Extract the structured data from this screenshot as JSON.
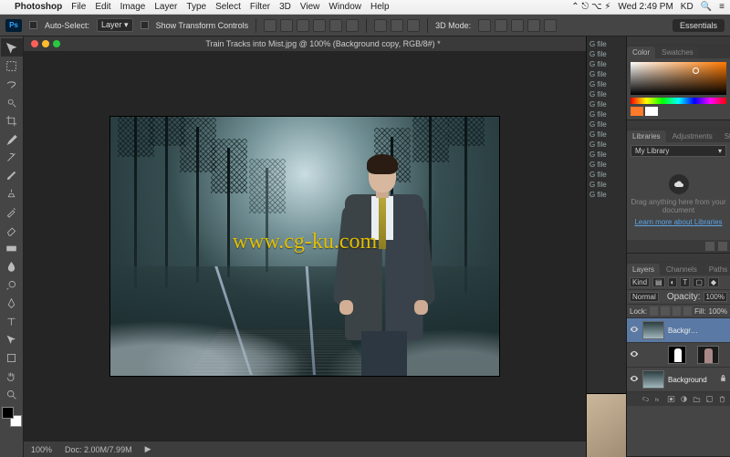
{
  "mac_menubar": {
    "apple_glyph": "",
    "app_name": "Photoshop",
    "items": [
      "File",
      "Edit",
      "Image",
      "Layer",
      "Type",
      "Select",
      "Filter",
      "3D",
      "View",
      "Window",
      "Help"
    ],
    "right_status": {
      "time": "Wed 2:49 PM",
      "user": "KD"
    },
    "right_icons": [
      "bluetooth-icon",
      "wifi-icon",
      "volume-icon",
      "battery-icon",
      "spotlight-icon",
      "notification-center-icon"
    ]
  },
  "options_bar": {
    "ps_badge": "Ps",
    "auto_select_label": "Auto-Select:",
    "auto_select_target": "Layer",
    "show_transform_label": "Show Transform Controls",
    "mode_3d_label": "3D Mode:",
    "workspace_label": "Essentials"
  },
  "tools": [
    "move",
    "rect-marquee",
    "lasso",
    "quick-select",
    "crop",
    "eyedropper",
    "healing",
    "brush",
    "clone",
    "history-brush",
    "eraser",
    "gradient",
    "blur",
    "dodge",
    "pen",
    "type",
    "path-select",
    "rectangle",
    "hand",
    "zoom"
  ],
  "document": {
    "tab_title": "Train Tracks into Mist.jpg @ 100% (Background copy, RGB/8#) *",
    "watermark": "www.cg-ku.com",
    "status_zoom": "100%",
    "status_doc": "Doc: 2.00M/7.99M"
  },
  "panels": {
    "color": {
      "tabs": [
        "Color",
        "Swatches"
      ]
    },
    "libraries": {
      "tabs": [
        "Libraries",
        "Adjustments",
        "Styles"
      ],
      "dropdown": "My Library",
      "hint": "Drag anything here from your document",
      "link": "Learn more about Libraries"
    },
    "layers": {
      "tabs": [
        "Layers",
        "Channels",
        "Paths"
      ],
      "kind_label": "Kind",
      "opacity_label": "Opacity:",
      "opacity_value": "100%",
      "fill_label": "Fill:",
      "fill_value": "100%",
      "lock_label": "Lock:",
      "blend_mode": "Normal",
      "rows": [
        {
          "name": "Backgr…",
          "selected": true,
          "has_mask": false,
          "locked": false,
          "thumb": "mist"
        },
        {
          "name": "",
          "selected": false,
          "has_mask": true,
          "locked": false,
          "thumb": "man"
        },
        {
          "name": "Background",
          "selected": false,
          "has_mask": false,
          "locked": true,
          "thumb": "mist"
        }
      ]
    }
  },
  "behind_files_label": "G file"
}
